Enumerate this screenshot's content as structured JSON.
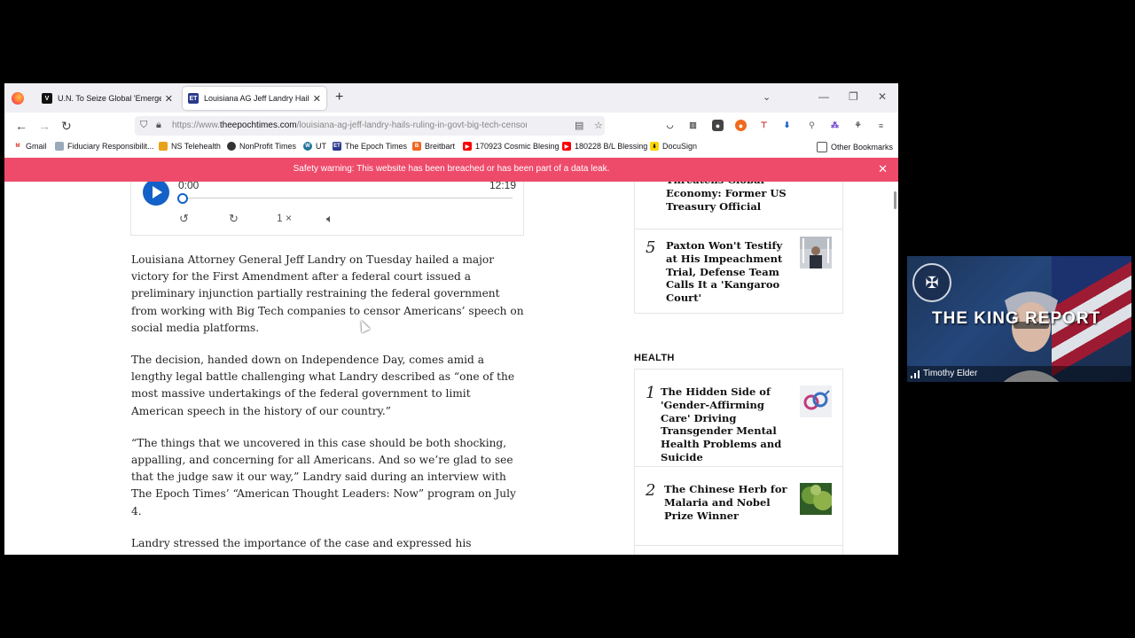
{
  "tabs": [
    {
      "title": "U.N. To Seize Global 'Emergenc",
      "favicon": "V"
    },
    {
      "title": "Louisiana AG Jeff Landry Hails R",
      "favicon": "ET"
    }
  ],
  "url": {
    "prefix": "https://www.",
    "domain": "theepochtimes.com",
    "path": "/louisiana-ag-jeff-landry-hails-ruling-in-govt-big-tech-censorship-"
  },
  "bookmarks": [
    {
      "label": "Gmail",
      "icon": "M"
    },
    {
      "label": "Fiduciary Responsibilit...",
      "icon": ""
    },
    {
      "label": "NS Telehealth",
      "icon": ""
    },
    {
      "label": "NonProfit Times",
      "icon": ""
    },
    {
      "label": "UT",
      "icon": "W"
    },
    {
      "label": "The Epoch Times",
      "icon": "ET"
    },
    {
      "label": "Breitbart",
      "icon": "B"
    },
    {
      "label": "170923 Cosmic Blesing",
      "icon": ""
    },
    {
      "label": "180228 B/L Blessing",
      "icon": ""
    },
    {
      "label": "DocuSign",
      "icon": ""
    }
  ],
  "other_bookmarks": "Other Bookmarks",
  "warning": "Safety warning: This website has been breached or has been part of a data leak.",
  "player": {
    "current": "0:00",
    "duration": "12:19",
    "speed": "1 ×",
    "progress": 0
  },
  "article": [
    "Louisiana Attorney General Jeff Landry on Tuesday hailed a major victory for the First Amendment after a federal court issued a preliminary injunction partially restraining the federal government from working with Big Tech companies to censor Americans’ speech on social media platforms.",
    "The decision, handed down on Independence Day, comes amid a lengthy legal battle challenging what Landry described as “one of the most massive undertakings of the federal government to limit American speech in the history of our country.”",
    "“The things that we uncovered in this case should be both shocking, appalling, and concerning for all Americans. And so we’re glad to see that the judge saw it our way,” Landry said during an interview with The Epoch Times’ “American Thought Leaders: Now” program on July 4.",
    "Landry stressed the importance of the case and expressed his satisfaction with the court’s decision. “It’s a great day today. I mean, what a day to"
  ],
  "sidebar": {
    "top_partial": "Threatens Global Economy: Former US Treasury Official",
    "item5": {
      "rank": "5",
      "title": "Paxton Won't Testify at His Impeachment Trial, Defense Team Calls It a 'Kangaroo Court'"
    },
    "section": "HEALTH",
    "health": [
      {
        "rank": "1",
        "title": "The Hidden Side of 'Gender-Affirming Care' Driving Transgender Mental Health Problems and Suicide"
      },
      {
        "rank": "2",
        "title": "The Chinese Herb for Malaria and Nobel Prize Winner"
      }
    ]
  },
  "webcam": {
    "title": "THE KING REPORT",
    "name": "Timothy Elder"
  }
}
